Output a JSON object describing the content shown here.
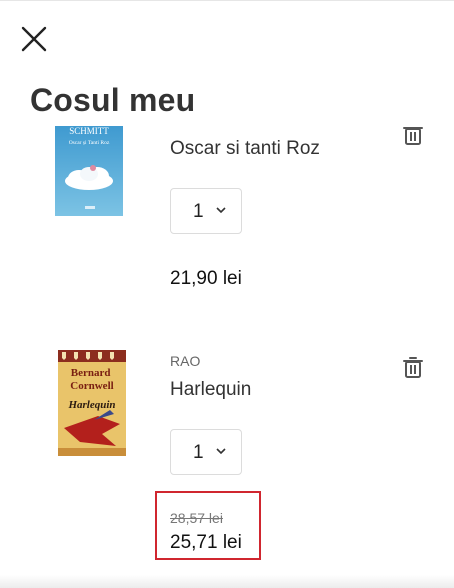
{
  "header": {
    "title": "Cosul meu",
    "close_icon": "close-icon"
  },
  "cart": {
    "items": [
      {
        "cover": {
          "author_text": "SCHMITT",
          "title_text": "Oscar și Tanti Roz"
        },
        "publisher": "",
        "title": "Oscar si tanti Roz",
        "quantity": "1",
        "price": "21,90 lei"
      },
      {
        "cover": {
          "author_text": "Bernard Cornwell",
          "title_text": "Harlequin"
        },
        "publisher": "RAO",
        "title": "Harlequin",
        "quantity": "1",
        "old_price": "28,57 lei",
        "price": "25,71 lei"
      }
    ]
  },
  "colors": {
    "highlight": "#d0262f",
    "text": "#333333",
    "muted": "#666666"
  }
}
